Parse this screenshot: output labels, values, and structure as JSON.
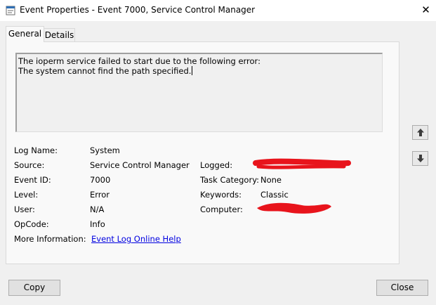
{
  "window": {
    "title": "Event Properties - Event 7000, Service Control Manager",
    "close_glyph": "✕"
  },
  "tabs": [
    {
      "label": "General",
      "active": true
    },
    {
      "label": "Details",
      "active": false
    }
  ],
  "message": {
    "line1": "The ioperm service failed to start due to the following error:",
    "line2": "The system cannot find the path specified."
  },
  "fields": {
    "log_name": {
      "label": "Log Name:",
      "value": "System"
    },
    "source": {
      "label": "Source:",
      "value": "Service Control Manager"
    },
    "event_id": {
      "label": "Event ID:",
      "value": "7000"
    },
    "level": {
      "label": "Level:",
      "value": "Error"
    },
    "user": {
      "label": "User:",
      "value": "N/A"
    },
    "opcode": {
      "label": "OpCode:",
      "value": "Info"
    },
    "more_info": {
      "label": "More Information:",
      "value": "Event Log Online Help"
    },
    "logged": {
      "label": "Logged:",
      "value": ""
    },
    "task_category": {
      "label": "Task Category:",
      "value": "None"
    },
    "keywords": {
      "label": "Keywords:",
      "value": "Classic"
    },
    "computer": {
      "label": "Computer:",
      "value": ""
    }
  },
  "nav": {
    "up_icon": "arrow-up-icon",
    "down_icon": "arrow-down-icon"
  },
  "buttons": {
    "copy": "Copy",
    "close": "Close"
  },
  "colors": {
    "redaction": "#e8141c",
    "link": "#0000e0"
  }
}
